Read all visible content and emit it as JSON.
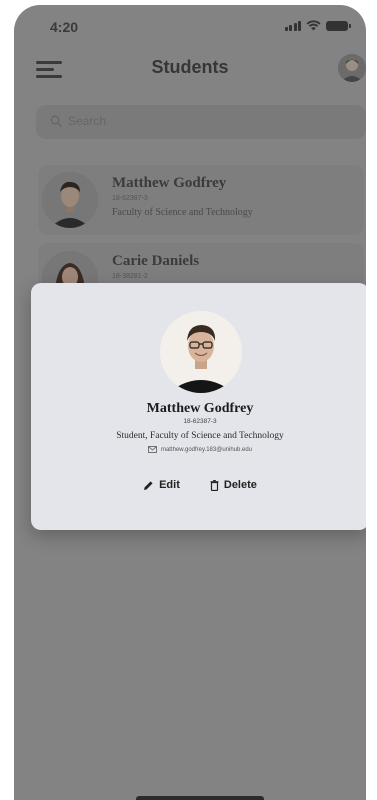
{
  "status_bar": {
    "time": "4:20"
  },
  "header": {
    "title": "Students"
  },
  "search": {
    "placeholder": "Search"
  },
  "students": [
    {
      "name": "Matthew Godfrey",
      "id": "18-62387-3",
      "faculty": "Faculty of Science and Technology"
    },
    {
      "name": "Carie Daniels",
      "id": "18-38281-2"
    }
  ],
  "detail": {
    "name": "Matthew Godfrey",
    "id": "18-62387-3",
    "role": "Student, Faculty of Science and Technology",
    "email": "matthew.godfrey.183@unihub.edu",
    "edit_label": "Edit",
    "delete_label": "Delete"
  },
  "colors": {
    "overlay_bg": "#838383",
    "modal_bg": "#e3e5ea",
    "text_dark": "#1c1c1c"
  },
  "icons": [
    "menu-icon",
    "search-icon",
    "email-icon",
    "pencil-icon",
    "trash-icon",
    "signal-icon",
    "wifi-icon",
    "battery-icon"
  ]
}
